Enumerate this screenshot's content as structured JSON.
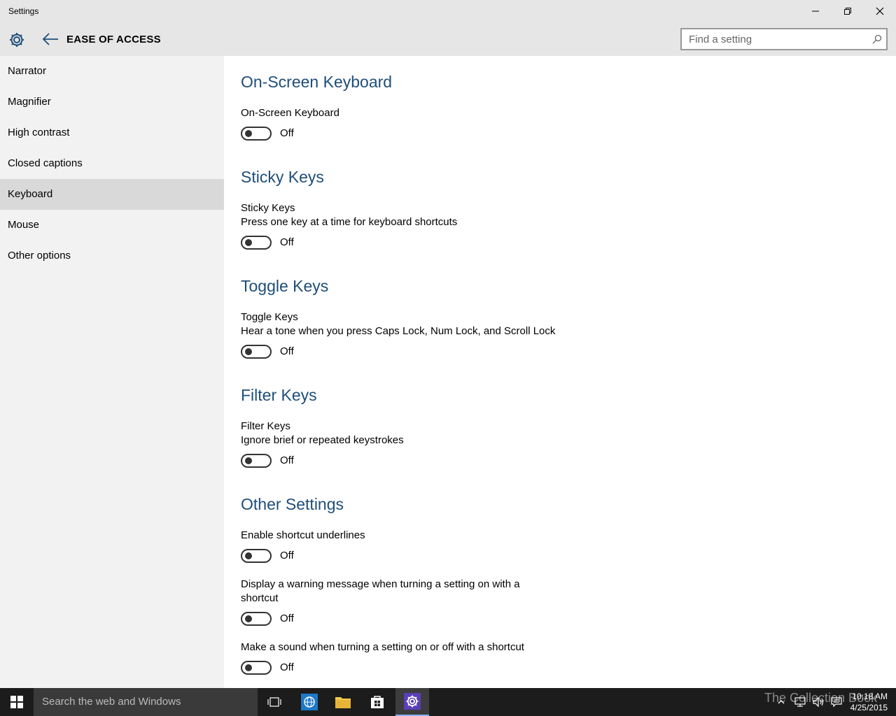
{
  "window": {
    "title": "Settings"
  },
  "header": {
    "section": "EASE OF ACCESS",
    "search_placeholder": "Find a setting"
  },
  "sidebar": {
    "items": [
      {
        "label": "Narrator"
      },
      {
        "label": "Magnifier"
      },
      {
        "label": "High contrast"
      },
      {
        "label": "Closed captions"
      },
      {
        "label": "Keyboard",
        "selected": true
      },
      {
        "label": "Mouse"
      },
      {
        "label": "Other options"
      }
    ]
  },
  "main": {
    "osk": {
      "title": "On-Screen Keyboard",
      "setting": "On-Screen Keyboard",
      "state": "Off"
    },
    "sticky": {
      "title": "Sticky Keys",
      "setting": "Sticky Keys",
      "desc": "Press one key at a time for keyboard shortcuts",
      "state": "Off"
    },
    "toggle": {
      "title": "Toggle Keys",
      "setting": "Toggle Keys",
      "desc": "Hear a tone when you press Caps Lock, Num Lock, and Scroll Lock",
      "state": "Off"
    },
    "filter": {
      "title": "Filter Keys",
      "setting": "Filter Keys",
      "desc": "Ignore brief or repeated keystrokes",
      "state": "Off"
    },
    "other": {
      "title": "Other Settings",
      "underlines": {
        "setting": "Enable shortcut underlines",
        "state": "Off"
      },
      "warning": {
        "setting_line1": "Display a warning message when turning a setting on with a",
        "setting_line2": "shortcut",
        "state": "Off"
      },
      "sound": {
        "setting": "Make a sound when turning a setting on or off with a shortcut",
        "state": "Off"
      }
    }
  },
  "taskbar": {
    "search_placeholder": "Search the web and Windows",
    "watermark": "The Collection Book",
    "time": "10:18 AM",
    "date": "4/25/2015"
  },
  "colors": {
    "accent_heading": "#1f4e79",
    "sidebar_bg": "#f2f2f2",
    "titlebar_bg": "#e6e6e6",
    "selected_bg": "#d9d9d9"
  },
  "icons": [
    "gear-icon",
    "back-arrow-icon",
    "search-icon",
    "minimize-icon",
    "restore-icon",
    "close-icon",
    "windows-start-icon",
    "task-view-icon",
    "edge-browser-icon",
    "file-explorer-icon",
    "store-icon",
    "settings-app-icon"
  ]
}
